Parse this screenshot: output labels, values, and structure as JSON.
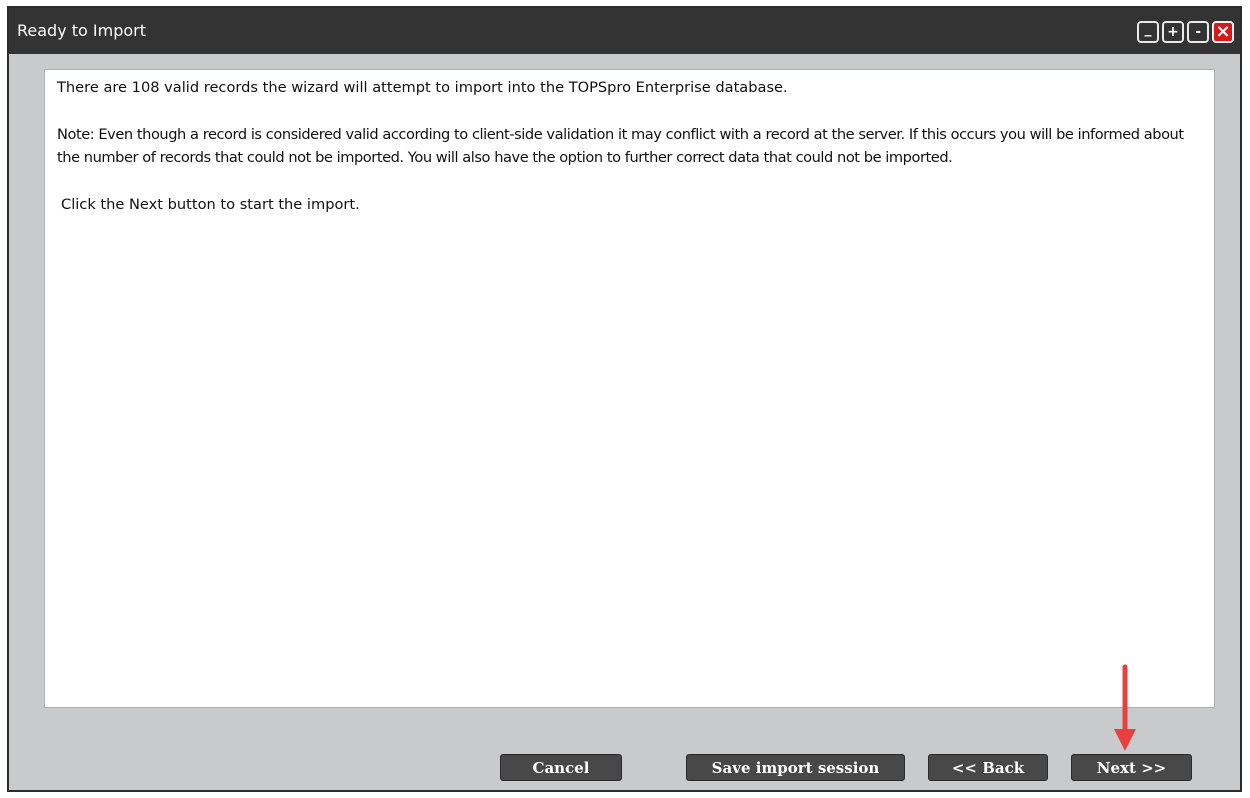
{
  "window": {
    "title": "Ready to Import",
    "controls": {
      "minimize": "_",
      "zoom_in": "+",
      "zoom_out": "-",
      "close": "×"
    }
  },
  "message": {
    "paragraph1": "There are 108 valid records the wizard will attempt to import into the TOPSpro Enterprise database.",
    "paragraph2": "Note: Even though a record is considered valid according to client-side validation it may conflict with a record at the server. If this occurs you will be informed about the number of records that could not be imported. You will also have the option to further correct data that could not be imported.",
    "paragraph3": "Click the Next button to start the import."
  },
  "buttons": {
    "cancel": "Cancel",
    "save": "Save import session",
    "back": "<< Back",
    "next": "Next >>"
  },
  "colors": {
    "annotation_arrow": "#e8403f",
    "titlebar": "#333333",
    "button": "#484848",
    "close": "#d4191c"
  }
}
